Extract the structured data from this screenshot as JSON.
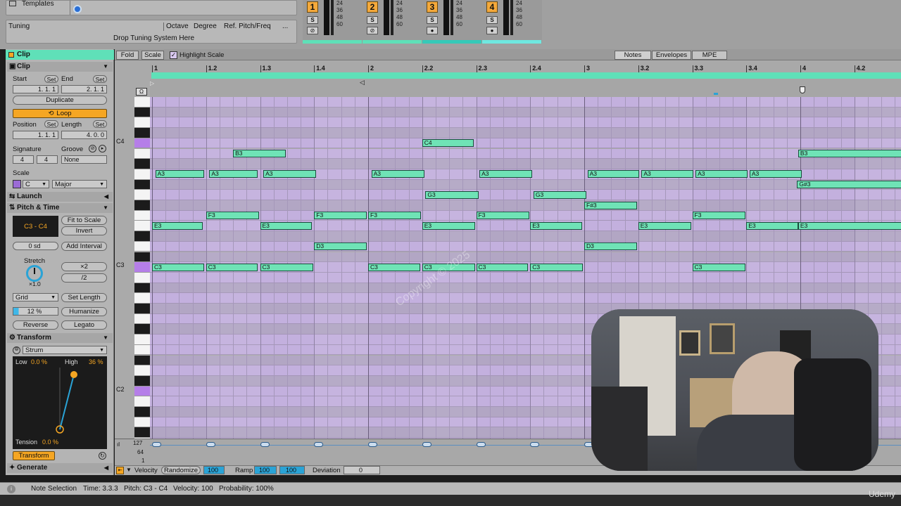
{
  "top": {
    "templates_label": "Templates",
    "tuning_label": "Tuning",
    "tuning_cols": [
      "Octave",
      "Degree",
      "Ref. Pitch/Freq",
      "..."
    ],
    "tuning_drop": "Drop Tuning System Here",
    "meter_scale": [
      "24",
      "36",
      "48",
      "60"
    ],
    "channels": [
      {
        "num": "1",
        "solo": "S",
        "color": "#5fe0b8"
      },
      {
        "num": "2",
        "solo": "S",
        "color": "#5fe0b8"
      },
      {
        "num": "3",
        "solo": "S",
        "color": "#35c9b8"
      },
      {
        "num": "4",
        "solo": "S",
        "color": "#6fe8e0"
      }
    ]
  },
  "clip": {
    "header": "Clip",
    "section": "Clip",
    "start_label": "Start",
    "end_label": "End",
    "set": "Set",
    "start_value": "1.  1.  1",
    "end_value": "2.  1.  1",
    "duplicate": "Duplicate",
    "loop": "Loop",
    "position_label": "Position",
    "length_label": "Length",
    "position_value": "1.  1.  1",
    "length_value": "4.  0.  0",
    "signature_label": "Signature",
    "groove_label": "Groove",
    "sig_num": "4",
    "sig_den": "4",
    "groove_value": "None",
    "scale_label": "Scale",
    "scale_root": "C",
    "scale_name": "Major",
    "launch": "Launch",
    "pitch_time": "Pitch & Time",
    "range": "C3 - C4",
    "fit_to_scale": "Fit to Scale",
    "invert": "Invert",
    "transpose_value": "0 sd",
    "add_interval": "Add Interval",
    "stretch_label": "Stretch",
    "stretch_value": "×1.0",
    "times2": "×2",
    "div2": "/2",
    "grid": "Grid",
    "set_length": "Set Length",
    "humanize_pct": "12 %",
    "humanize": "Humanize",
    "reverse": "Reverse",
    "legato": "Legato",
    "transform": "Transform",
    "strum": "Strum",
    "low_label": "Low",
    "low_value": "0.0 %",
    "high_label": "High",
    "high_value": "36 %",
    "tension_label": "Tension",
    "tension_value": "0.0 %",
    "transform_button": "Transform",
    "generate": "Generate"
  },
  "editor": {
    "fold": "Fold",
    "scale": "Scale",
    "highlight_scale": "Highlight Scale",
    "tabs": [
      "Notes",
      "Envelopes",
      "MPE"
    ],
    "ruler": [
      "1",
      "1.2",
      "1.3",
      "1.4",
      "2",
      "2.2",
      "2.3",
      "2.4",
      "3",
      "3.2",
      "3.3",
      "3.4",
      "4",
      "4.2"
    ],
    "key_labels": [
      "C4",
      "C3",
      "C2"
    ],
    "velocity_scale": [
      "127",
      "64",
      "1"
    ],
    "notes": [
      {
        "pitch": "C4",
        "start": 2.25,
        "len": 0.24
      },
      {
        "pitch": "B3",
        "start": 1.375,
        "len": 0.245
      },
      {
        "pitch": "B3",
        "start": 3.99,
        "len": 0.5
      },
      {
        "pitch": "A3",
        "start": 1.015,
        "len": 0.225
      },
      {
        "pitch": "A3",
        "start": 1.265,
        "len": 0.225
      },
      {
        "pitch": "A3",
        "start": 1.515,
        "len": 0.245
      },
      {
        "pitch": "A3",
        "start": 2.015,
        "len": 0.245
      },
      {
        "pitch": "A3",
        "start": 2.515,
        "len": 0.245
      },
      {
        "pitch": "A3",
        "start": 3.015,
        "len": 0.24
      },
      {
        "pitch": "A3",
        "start": 3.265,
        "len": 0.24
      },
      {
        "pitch": "A3",
        "start": 3.515,
        "len": 0.24
      },
      {
        "pitch": "A3",
        "start": 3.765,
        "len": 0.24
      },
      {
        "pitch": "G#3",
        "start": 3.985,
        "len": 0.5
      },
      {
        "pitch": "G3",
        "start": 2.265,
        "len": 0.245
      },
      {
        "pitch": "G3",
        "start": 2.765,
        "len": 0.245
      },
      {
        "pitch": "F#3",
        "start": 3.0,
        "len": 0.245
      },
      {
        "pitch": "F3",
        "start": 1.25,
        "len": 0.245
      },
      {
        "pitch": "F3",
        "start": 1.75,
        "len": 0.245
      },
      {
        "pitch": "F3",
        "start": 2.0,
        "len": 0.245
      },
      {
        "pitch": "F3",
        "start": 2.5,
        "len": 0.245
      },
      {
        "pitch": "F3",
        "start": 3.5,
        "len": 0.245
      },
      {
        "pitch": "E3",
        "start": 1.0,
        "len": 0.235
      },
      {
        "pitch": "E3",
        "start": 1.5,
        "len": 0.24
      },
      {
        "pitch": "E3",
        "start": 2.25,
        "len": 0.245
      },
      {
        "pitch": "E3",
        "start": 2.75,
        "len": 0.24
      },
      {
        "pitch": "E3",
        "start": 3.25,
        "len": 0.245
      },
      {
        "pitch": "E3",
        "start": 3.75,
        "len": 0.24
      },
      {
        "pitch": "E3",
        "start": 3.99,
        "len": 0.5
      },
      {
        "pitch": "D3",
        "start": 1.75,
        "len": 0.245
      },
      {
        "pitch": "D3",
        "start": 3.0,
        "len": 0.245
      },
      {
        "pitch": "C3",
        "start": 1.0,
        "len": 0.24
      },
      {
        "pitch": "C3",
        "start": 1.25,
        "len": 0.24
      },
      {
        "pitch": "C3",
        "start": 1.5,
        "len": 0.245
      },
      {
        "pitch": "C3",
        "start": 2.0,
        "len": 0.24
      },
      {
        "pitch": "C3",
        "start": 2.25,
        "len": 0.245
      },
      {
        "pitch": "C3",
        "start": 2.5,
        "len": 0.24
      },
      {
        "pitch": "C3",
        "start": 2.75,
        "len": 0.245
      },
      {
        "pitch": "C3",
        "start": 3.5,
        "len": 0.245
      }
    ],
    "velocity": "Velocity",
    "randomize": "Randomize",
    "vel_value": "100",
    "ramp": "Ramp",
    "ramp_a": "100",
    "ramp_b": "100",
    "deviation": "Deviation",
    "deviation_value": "0"
  },
  "status": {
    "selection": "Note Selection",
    "time": "Time: 3.3.3",
    "pitch": "Pitch: C3 - C4",
    "velocity": "Velocity: 100",
    "probability": "Probability: 100%"
  },
  "watermark": "Udemy",
  "overlay_text": "Copyright © 2025"
}
